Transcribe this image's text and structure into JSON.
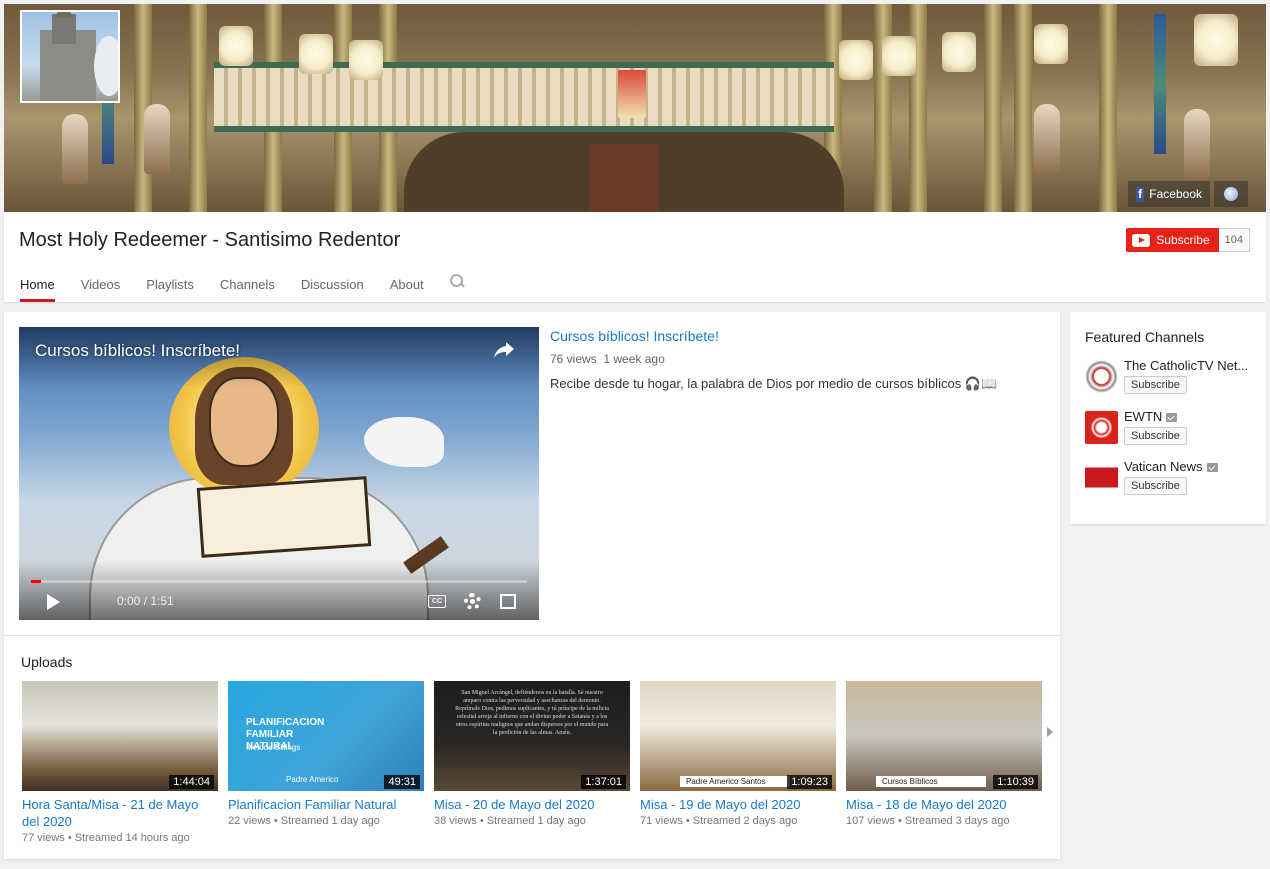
{
  "channel": {
    "title": "Most Holy Redeemer - Santisimo Redentor",
    "subscribe_label": "Subscribe",
    "subscriber_count": "104",
    "banner_links": [
      {
        "label": "Facebook",
        "icon": "facebook-icon"
      },
      {
        "label": "",
        "icon": "globe-icon"
      }
    ]
  },
  "tabs": [
    {
      "label": "Home",
      "active": true
    },
    {
      "label": "Videos"
    },
    {
      "label": "Playlists"
    },
    {
      "label": "Channels"
    },
    {
      "label": "Discussion"
    },
    {
      "label": "About"
    }
  ],
  "featured_video": {
    "player_title": "Cursos bíblicos! Inscríbete!",
    "title": "Cursos bíblicos! Inscríbete!",
    "views": "76 views",
    "age": "1 week ago",
    "description": "Recibe desde tu hogar, la palabra de Dios por medio de cursos bíblicos 🎧📖",
    "time_display": "0:00 / 1:51",
    "progress_fraction": 0.0,
    "cc_label": "CC"
  },
  "uploads": {
    "title": "Uploads",
    "items": [
      {
        "title": "Hora Santa/Misa - 21 de Mayo del 2020",
        "duration": "1:44:04",
        "views": "77 views",
        "streamed": "Streamed 14 hours ago"
      },
      {
        "title": "Planificacion Familiar Natural",
        "duration": "49:31",
        "views": "22 views",
        "streamed": "Streamed 1 day ago",
        "thumb_text": "PLANIFICACION FAMILIAR NATURAL",
        "thumb_sub": "Metodo Billings",
        "thumb_name": "Padre Americo"
      },
      {
        "title": "Misa - 20 de Mayo del 2020",
        "duration": "1:37:01",
        "views": "38 views",
        "streamed": "Streamed 1 day ago",
        "thumb_text": "San Miguel Arcángel, defiéndenos en la batalla. Sé nuestro amparo contra las perversidad y asechanzas del demonio. Reprímale Dios, pedimos suplicantes, y tú príncipe de la milicia celestial arroja al infierno con el divino poder a Satanás y a los otros espíritus malignos que andan dispersos por el mundo para la perdición de las almas. Amén."
      },
      {
        "title": "Misa - 19 de Mayo del 2020",
        "duration": "1:09:23",
        "views": "71 views",
        "streamed": "Streamed 2 days ago",
        "thumb_name": "Padre Americo Santos"
      },
      {
        "title": "Misa - 18 de Mayo del 2020",
        "duration": "1:10:39",
        "views": "107 views",
        "streamed": "Streamed 3 days ago",
        "thumb_name": "Cursos Bíblicos"
      }
    ]
  },
  "featured_channels": {
    "title": "Featured Channels",
    "items": [
      {
        "name": "The CatholicTV Net...",
        "subscribe": "Subscribe",
        "verified": false,
        "color": "#ffffff"
      },
      {
        "name": "EWTN",
        "subscribe": "Subscribe",
        "verified": true,
        "color": "#d9241c"
      },
      {
        "name": "Vatican News",
        "subscribe": "Subscribe",
        "verified": true,
        "color": "#c8191f"
      }
    ]
  },
  "colors": {
    "accent": "#e62117",
    "link": "#167ac6",
    "tab_active": "#cc181e"
  }
}
